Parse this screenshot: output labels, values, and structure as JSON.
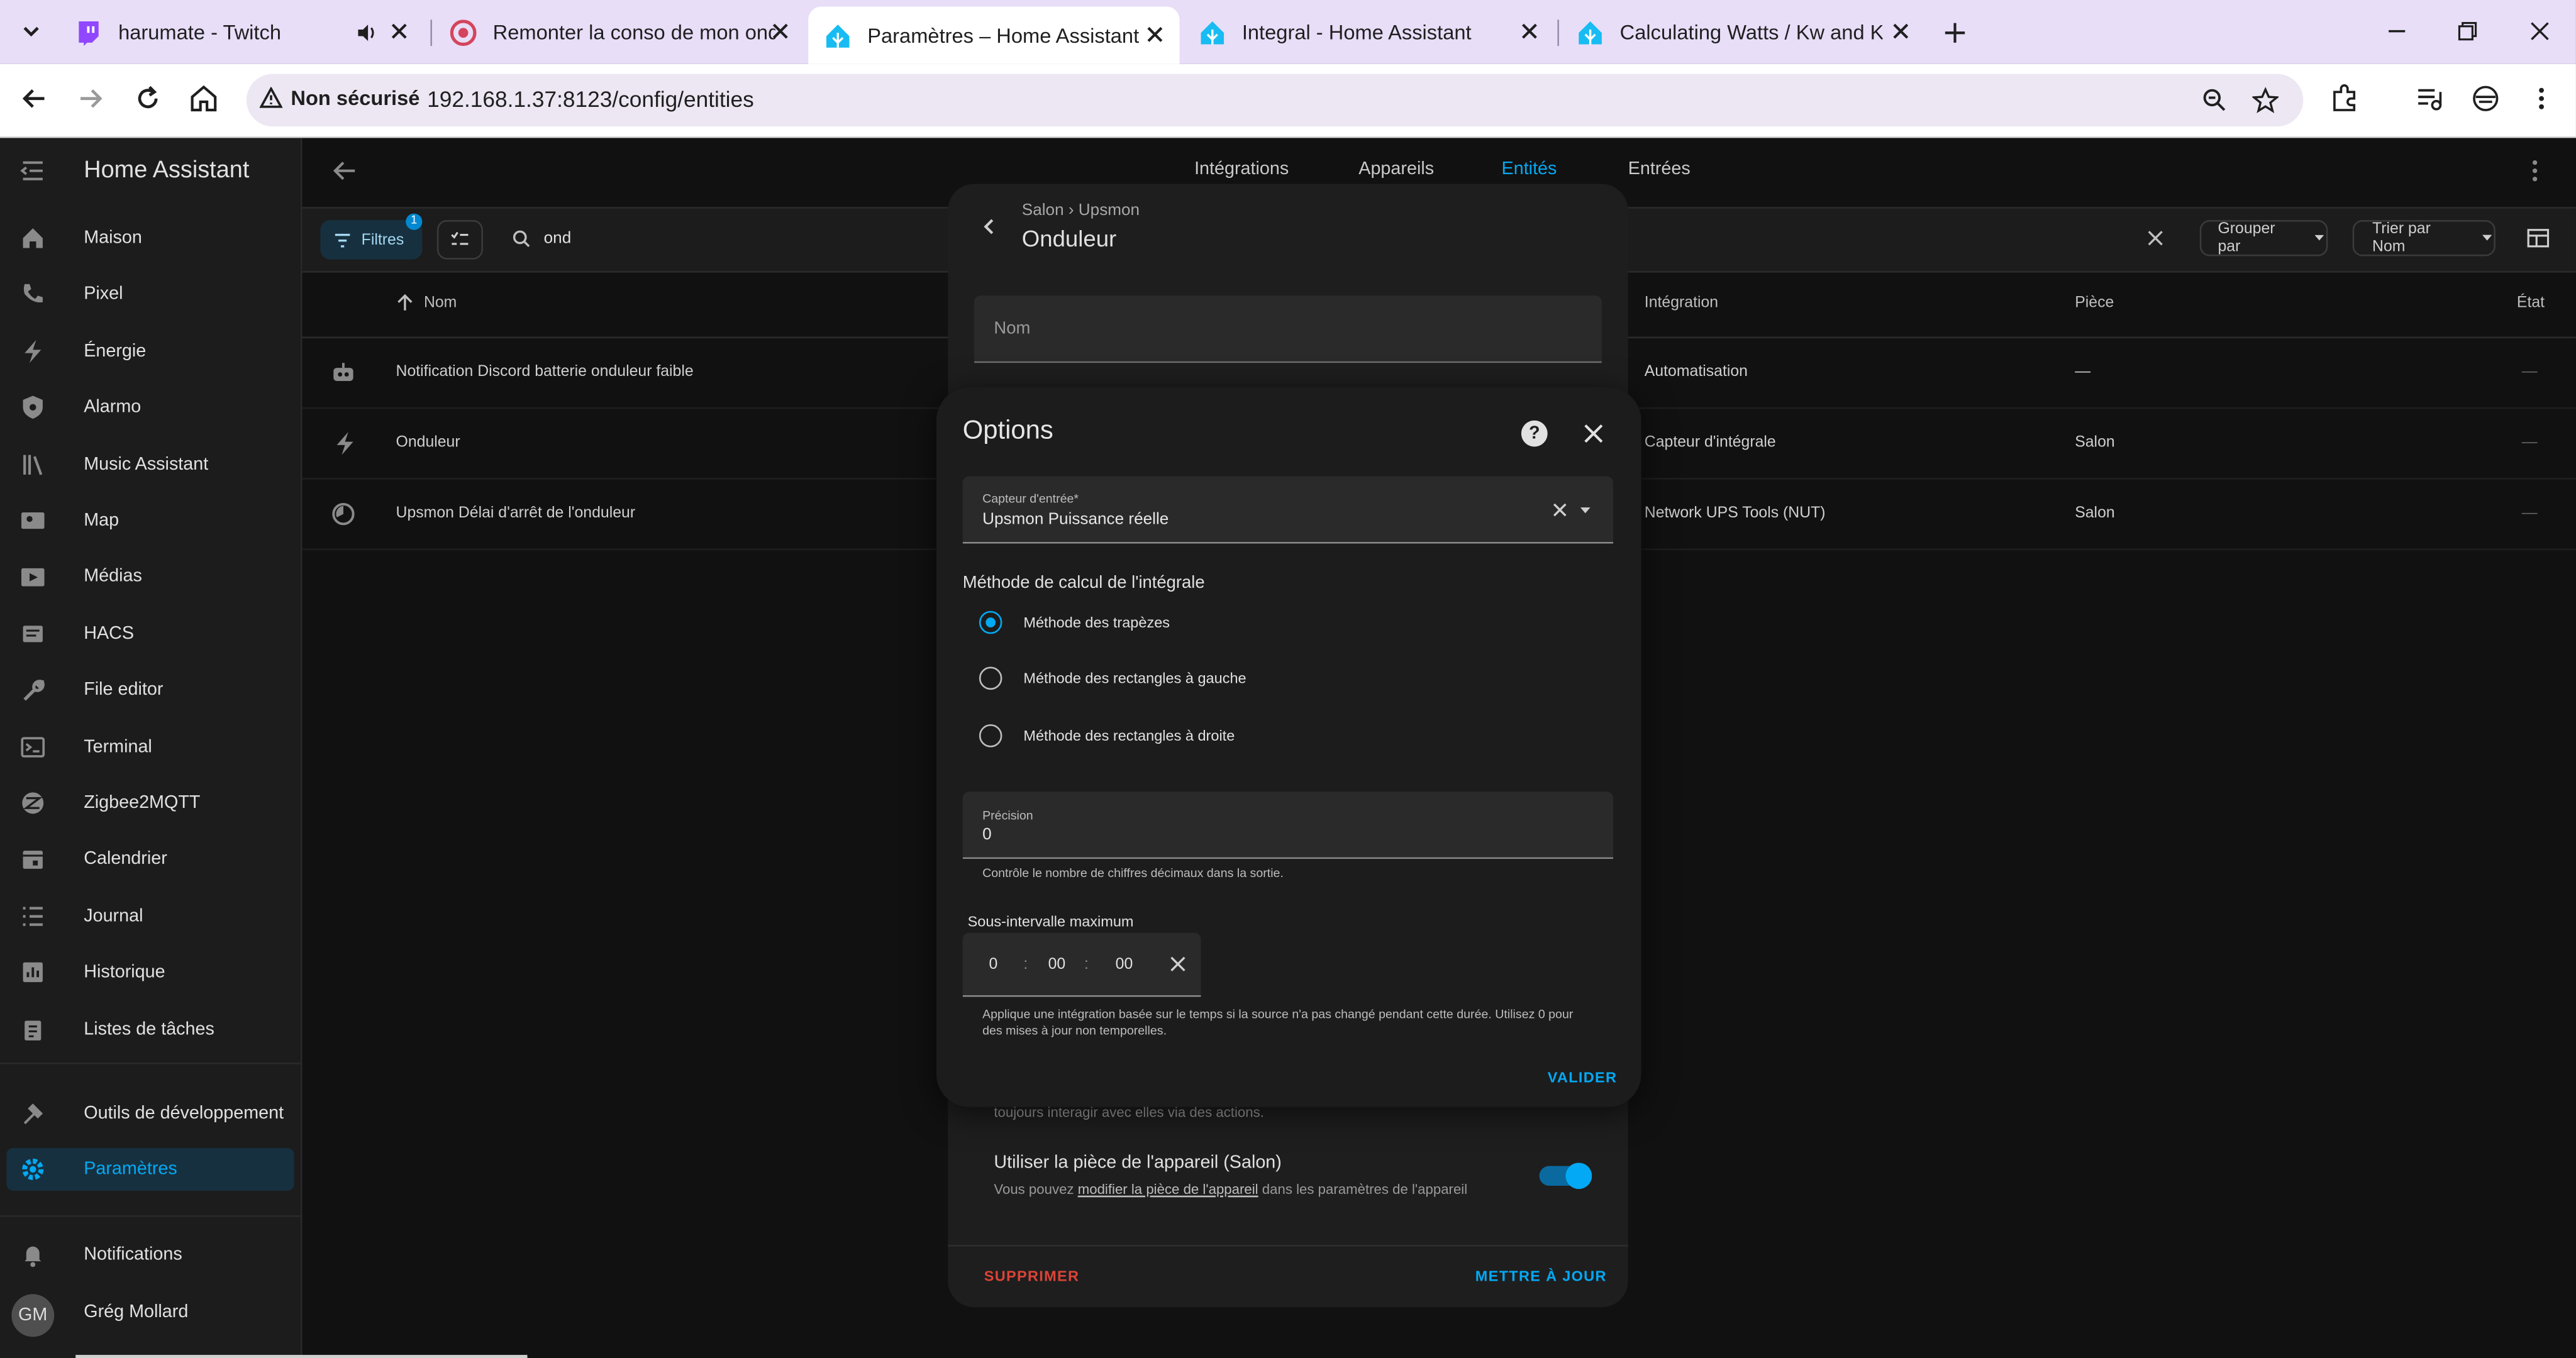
{
  "browser": {
    "tabs": [
      {
        "title": "harumate - Twitch",
        "icon": "twitch-icon",
        "audio": true
      },
      {
        "title": "Remonter la conso de mon ond",
        "icon": "forum-icon"
      },
      {
        "title": "Paramètres – Home Assistant",
        "icon": "home-assistant-icon",
        "active": true
      },
      {
        "title": "Integral - Home Assistant",
        "icon": "home-assistant-icon"
      },
      {
        "title": "Calculating Watts / Kw and KWh",
        "icon": "home-assistant-icon"
      }
    ],
    "security_label": "Non sécurisé",
    "url": "192.168.1.37:8123/config/entities"
  },
  "sidebar": {
    "title": "Home Assistant",
    "items": [
      {
        "label": "Maison",
        "icon": "home-icon"
      },
      {
        "label": "Pixel",
        "icon": "phone-icon"
      },
      {
        "label": "Énergie",
        "icon": "lightning-icon"
      },
      {
        "label": "Alarmo",
        "icon": "shield-icon"
      },
      {
        "label": "Music Assistant",
        "icon": "music-library-icon"
      },
      {
        "label": "Map",
        "icon": "map-icon"
      },
      {
        "label": "Médias",
        "icon": "media-icon"
      },
      {
        "label": "HACS",
        "icon": "hacs-icon"
      },
      {
        "label": "File editor",
        "icon": "wrench-icon"
      },
      {
        "label": "Terminal",
        "icon": "terminal-icon"
      },
      {
        "label": "Zigbee2MQTT",
        "icon": "zigbee-icon"
      },
      {
        "label": "Calendrier",
        "icon": "calendar-icon"
      },
      {
        "label": "Journal",
        "icon": "list-icon"
      },
      {
        "label": "Historique",
        "icon": "chart-icon"
      },
      {
        "label": "Listes de tâches",
        "icon": "clipboard-icon"
      }
    ],
    "dev_tools": "Outils de développement",
    "settings": "Paramètres",
    "notifications": "Notifications",
    "user_name": "Grég Mollard",
    "user_initials": "GM"
  },
  "main": {
    "tabs": [
      "Intégrations",
      "Appareils",
      "Entités",
      "Entrées"
    ],
    "active_tab": "Entités",
    "filters_label": "Filtres",
    "filters_count": "1",
    "search_value": "ond",
    "group_by": "Grouper par",
    "sort_by": "Trier par Nom",
    "columns": {
      "name": "Nom",
      "integration": "Intégration",
      "area": "Pièce",
      "status": "État"
    },
    "rows": [
      {
        "name": "Notification Discord batterie onduleur faible",
        "integration": "Automatisation",
        "area": "—",
        "status": "—",
        "icon": "robot-icon"
      },
      {
        "name": "Onduleur",
        "integration": "Capteur d'intégrale",
        "area": "Salon",
        "status": "—",
        "icon": "lightning-icon"
      },
      {
        "name": "Upsmon Délai d'arrêt de l'onduleur",
        "integration": "Network UPS Tools (NUT)",
        "area": "Salon",
        "status": "—",
        "icon": "timer-icon"
      }
    ]
  },
  "entity_dialog": {
    "breadcrumb": "Salon › Upsmon",
    "title": "Onduleur",
    "name_placeholder": "Nom",
    "hidden_text": "toujours interagir avec elles via des actions.",
    "area_title": "Utiliser la pièce de l'appareil (Salon)",
    "area_desc_before": "Vous pouvez ",
    "area_desc_link": "modifier la pièce de l'appareil",
    "area_desc_after": " dans les paramètres de l'appareil",
    "delete": "SUPPRIMER",
    "update": "METTRE À JOUR"
  },
  "options_dialog": {
    "title": "Options",
    "sensor_label": "Capteur d'entrée*",
    "sensor_value": "Upsmon Puissance réelle",
    "method_title": "Méthode de calcul de l'intégrale",
    "methods": [
      {
        "label": "Méthode des trapèzes",
        "selected": true
      },
      {
        "label": "Méthode des rectangles à gauche",
        "selected": false
      },
      {
        "label": "Méthode des rectangles à droite",
        "selected": false
      }
    ],
    "precision_label": "Précision",
    "precision_value": "0",
    "precision_help": "Contrôle le nombre de chiffres décimaux dans la sortie.",
    "sub_interval_title": "Sous-intervalle maximum",
    "duration": {
      "hours": "0",
      "minutes": "00",
      "seconds": "00"
    },
    "sub_interval_help": "Applique une intégration basée sur le temps si la source n'a pas changé pendant cette durée. Utilisez 0 pour des mises à jour non temporelles.",
    "validate": "VALIDER"
  },
  "colors": {
    "accent": "#03a9f4",
    "danger": "#db4437",
    "browser_tabbar": "#e8def8",
    "background": "#111111"
  }
}
